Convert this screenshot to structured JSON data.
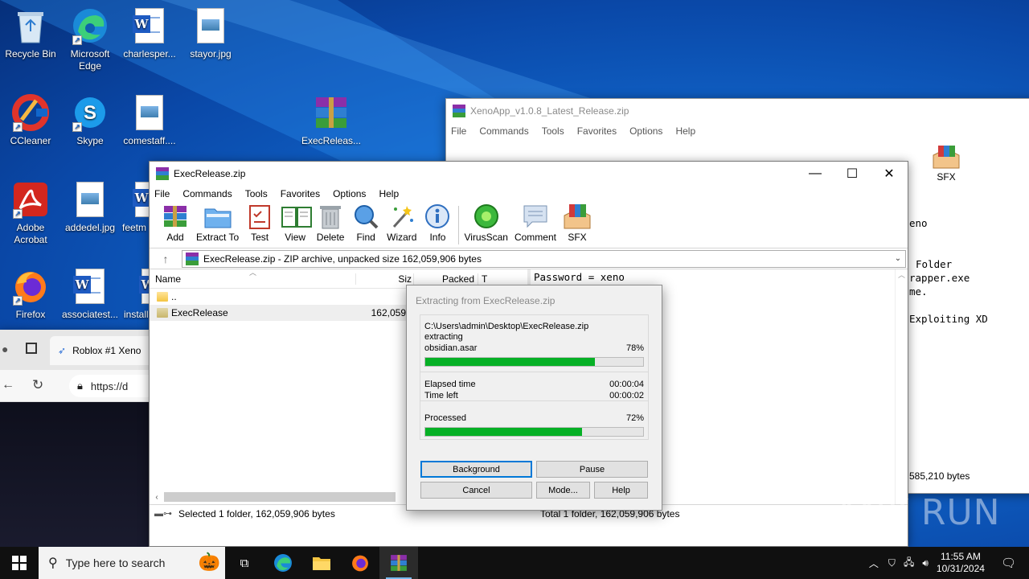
{
  "desktop": {
    "icons": [
      {
        "label": "Recycle Bin",
        "icon": "recycle-bin-icon"
      },
      {
        "label": "Microsoft Edge",
        "icon": "edge-icon"
      },
      {
        "label": "charlesper...",
        "icon": "word-doc-icon"
      },
      {
        "label": "stayor.jpg",
        "icon": "image-file-icon"
      },
      {
        "label": "CCleaner",
        "icon": "ccleaner-icon"
      },
      {
        "label": "Skype",
        "icon": "skype-icon"
      },
      {
        "label": "comestaff....",
        "icon": "image-file-icon"
      },
      {
        "label": "ExecReleas...",
        "icon": "winrar-archive-icon"
      },
      {
        "label": "Adobe Acrobat",
        "icon": "acrobat-icon"
      },
      {
        "label": "addedel.jpg",
        "icon": "image-file-icon"
      },
      {
        "label": "feetm",
        "icon": "word-doc-icon"
      },
      {
        "label": "Firefox",
        "icon": "firefox-icon"
      },
      {
        "label": "associatest...",
        "icon": "word-doc-icon"
      },
      {
        "label": "install",
        "icon": "word-doc-icon"
      }
    ]
  },
  "browser": {
    "tab_label": "Roblox #1 Xeno",
    "url": "https://d"
  },
  "bg_winrar": {
    "title": "XenoApp_v1.0.8_Latest_Release.zip",
    "menu": [
      "File",
      "Commands",
      "Tools",
      "Favorites",
      "Options",
      "Help"
    ],
    "toolbar_partial": [
      "nt",
      "SFX"
    ],
    "text_lines": [
      "eno",
      "",
      "",
      "Folder",
      "rapper.exe",
      "me.",
      "",
      "Exploiting XD"
    ],
    "status": "585,210 bytes"
  },
  "winrar": {
    "title": "ExecRelease.zip",
    "menu": [
      "File",
      "Commands",
      "Tools",
      "Favorites",
      "Options",
      "Help"
    ],
    "toolbar": [
      "Add",
      "Extract To",
      "Test",
      "View",
      "Delete",
      "Find",
      "Wizard",
      "Info",
      "VirusScan",
      "Comment",
      "SFX"
    ],
    "address": "ExecRelease.zip - ZIP archive, unpacked size 162,059,906 bytes",
    "columns": {
      "name": "Name",
      "size": "Siz",
      "packed": "Packed",
      "type": "T"
    },
    "rows": [
      {
        "name": "..",
        "size": ""
      },
      {
        "name": "ExecRelease",
        "size": "162,059,9"
      }
    ],
    "comment_text": "Password = xeno",
    "status_left": "Selected 1 folder, 162,059,906 bytes",
    "status_right": "Total 1 folder, 162,059,906 bytes"
  },
  "extract_dialog": {
    "title": "Extracting from ExecRelease.zip",
    "archive_path": "C:\\Users\\admin\\Desktop\\ExecRelease.zip",
    "action": "extracting",
    "current_file": "obsidian.asar",
    "file_percent_label": "78%",
    "file_progress": 78,
    "elapsed_label": "Elapsed time",
    "elapsed_value": "00:00:04",
    "left_label": "Time left",
    "left_value": "00:00:02",
    "processed_label": "Processed",
    "processed_percent_label": "72%",
    "processed_progress": 72,
    "buttons": {
      "background": "Background",
      "pause": "Pause",
      "cancel": "Cancel",
      "mode": "Mode...",
      "help": "Help"
    }
  },
  "taskbar": {
    "search_placeholder": "Type here to search",
    "time": "11:55 AM",
    "date": "10/31/2024"
  },
  "watermark": "ANY RUN",
  "colors": {
    "progress": "#06b025",
    "desktop": "#1167cc",
    "taskbar": "#101010"
  }
}
